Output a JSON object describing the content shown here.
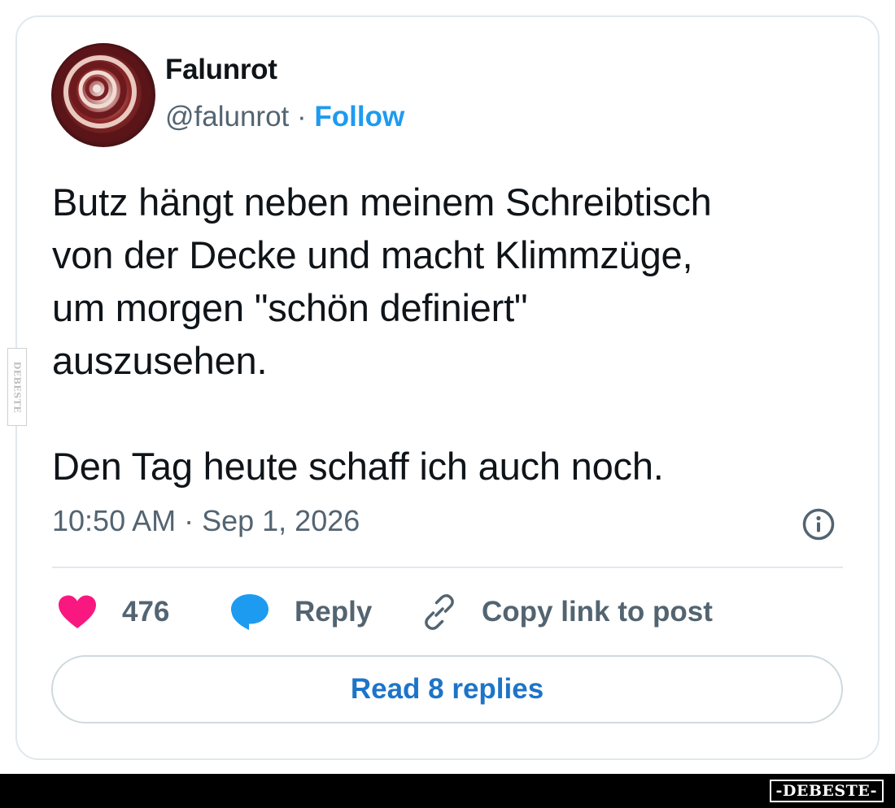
{
  "author": {
    "display_name": "Falunrot",
    "handle": "@falunrot",
    "separator": " · ",
    "follow_label": "Follow"
  },
  "tweet": {
    "text": "Butz hängt neben meinem Schreibtisch\nvon der Decke und macht Klimmzüge,\num morgen \"schön definiert\"\nauszusehen.\n\nDen Tag heute schaff ich auch noch.",
    "timestamp": "10:50 AM · Sep 1, 2026"
  },
  "actions": {
    "like_count": "476",
    "reply_label": "Reply",
    "copy_link_label": "Copy link to post"
  },
  "read_replies_label": "Read 8 replies",
  "watermark": {
    "side_text": "DEBESTE",
    "bottom_text": "-DEBESTE-"
  },
  "icons": {
    "avatar": "spiral-avatar",
    "info": "info-icon",
    "like": "heart-icon",
    "reply": "speech-bubble-icon",
    "copy_link": "link-icon"
  },
  "colors": {
    "heart": "#f91880",
    "reply_bubble": "#1d9bf0",
    "follow": "#1d9bf0",
    "read_replies_text": "#1d74c8",
    "secondary_text": "#536471"
  }
}
